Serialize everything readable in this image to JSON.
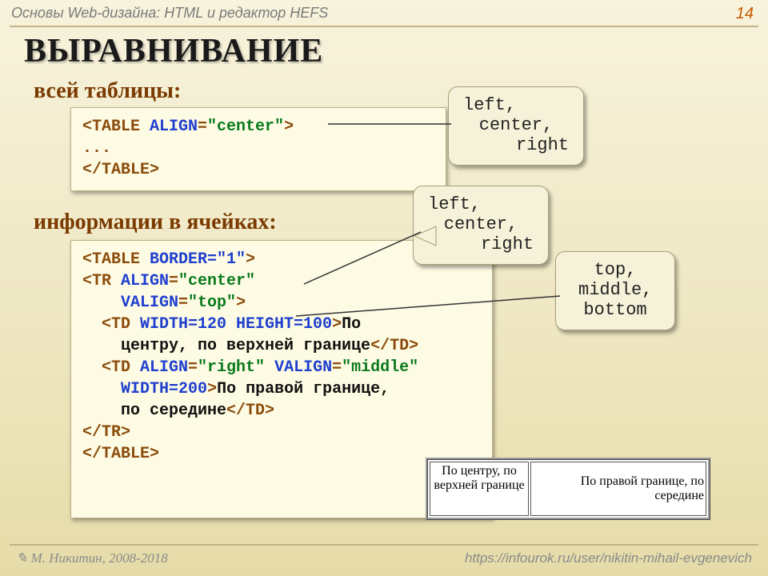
{
  "page": {
    "breadcrumb": "Основы Web-дизайна: HTML и редактор HEFS",
    "number": "14"
  },
  "title": "ВЫРАВНИВАНИЕ",
  "subhead1": "всей таблицы:",
  "subhead2": "информации в ячейках:",
  "callouts": {
    "align1_l1": "left,",
    "align1_l2": "center,",
    "align1_l3": "right",
    "align2_l1": "left,",
    "align2_l2": "center,",
    "align2_l3": "right",
    "valign_l1": "top,",
    "valign_l2": "middle,",
    "valign_l3": "bottom"
  },
  "code1": {
    "p1a": "<TABLE ",
    "p1b": "ALIGN",
    "p1c": "=",
    "p1d": "\"center\"",
    "p1e": ">",
    "p2": "...",
    "p3": "</TABLE>"
  },
  "code2": {
    "l1a": "<TABLE ",
    "l1b": "BORDER=\"1\"",
    "l1c": ">",
    "l2a": "<TR ",
    "l2b": "ALIGN",
    "l2c": "=",
    "l2d": "\"center\"",
    "l3a": "    ",
    "l3b": "VALIGN",
    "l3c": "=",
    "l3d": "\"top\"",
    "l3e": ">",
    "l4a": "  <TD ",
    "l4b": "WIDTH=120 HEIGHT=100",
    "l4c": ">",
    "l4d": "По",
    "l5a": "    центру, по верхней границе",
    "l5b": "</TD>",
    "l6a": "  <TD ",
    "l6b": "ALIGN",
    "l6c": "=",
    "l6d": "\"right\" ",
    "l6e": "VALIGN",
    "l6f": "=",
    "l6g": "\"middle\"",
    "l7a": "    ",
    "l7b": "WIDTH=200",
    "l7c": ">",
    "l7d": "По правой границе,",
    "l8a": "    по середине",
    "l8b": "</TD>",
    "l9": "</TR>",
    "l10": "</TABLE>"
  },
  "sample": {
    "cell1": "По центру, по верхней границе",
    "cell2": "По правой границе, по середине"
  },
  "footer": {
    "left_sym": "✎",
    "left_text": " М. Никитин, 2008-2018",
    "right": "https://infourok.ru/user/nikitin-mihail-evgenevich"
  }
}
